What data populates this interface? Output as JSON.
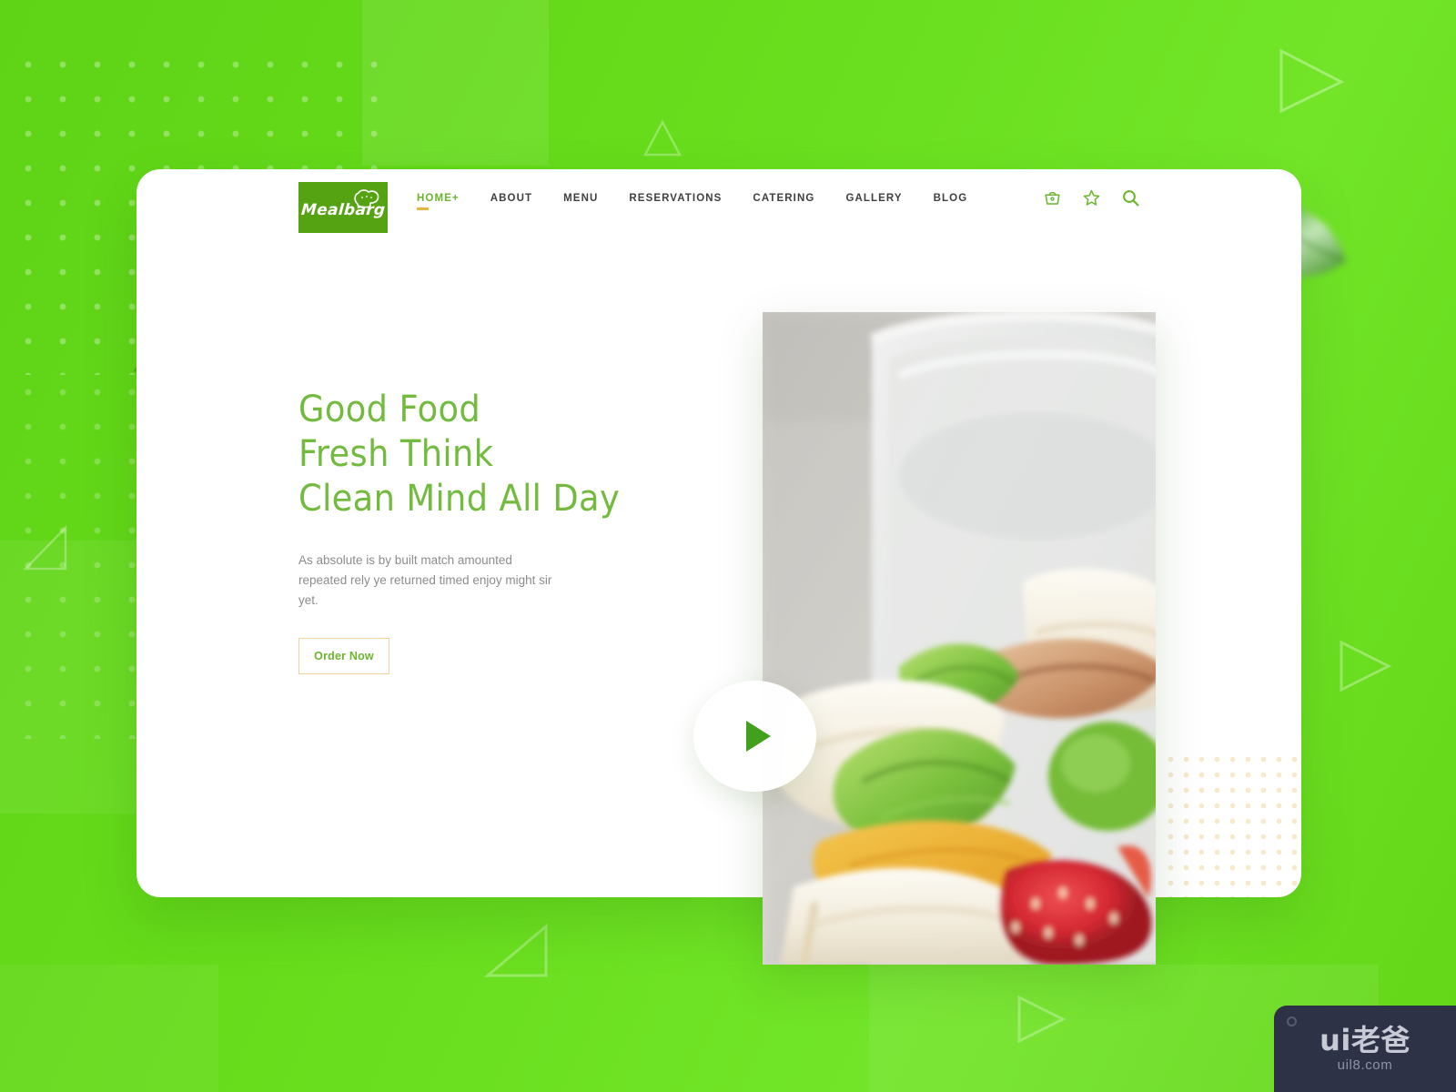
{
  "brand": {
    "logo_text": "Mealbarg",
    "logo_icon": "chef-hat-icon",
    "logo_bg": "#55a312"
  },
  "nav": {
    "items": [
      {
        "label": "HOME",
        "suffix": "+",
        "active": true
      },
      {
        "label": "ABOUT",
        "suffix": "",
        "active": false
      },
      {
        "label": "MENU",
        "suffix": "",
        "active": false
      },
      {
        "label": "RESERVATIONS",
        "suffix": "",
        "active": false
      },
      {
        "label": "CATERING",
        "suffix": "",
        "active": false
      },
      {
        "label": "GALLERY",
        "suffix": "",
        "active": false
      },
      {
        "label": "BLOG",
        "suffix": "",
        "active": false
      }
    ],
    "icons": [
      {
        "name": "basket-icon"
      },
      {
        "name": "star-icon"
      },
      {
        "name": "search-icon"
      }
    ],
    "active_color": "#6ab42e",
    "underline_color": "#e8b44a",
    "text_color": "#3f3f3f"
  },
  "hero": {
    "title_lines": [
      "Good Food",
      "Fresh Think",
      "Clean Mind All Day"
    ],
    "title_color": "#72bb3e",
    "paragraph": "As absolute is by built match amounted repeated rely ye returned timed enjoy might sir yet.",
    "cta_label": "Order Now",
    "cta_border_color": "#f2d49b",
    "cta_text_color": "#6cb52f",
    "play_button": "play-icon",
    "image_alt": "sandwich-skewers-in-container"
  },
  "decor": {
    "background_color": "#62d817",
    "card_background": "#ffffff",
    "dot_pattern_color": "#ffffff",
    "card_dot_pattern_color": "#f3d6a3",
    "leaves": [
      "leaf-top-right",
      "leaf-mid-left",
      "leaf-mid-right"
    ]
  },
  "watermark": {
    "main": "ui老爸",
    "sub": "uil8.com",
    "bg": "#2e3246"
  }
}
